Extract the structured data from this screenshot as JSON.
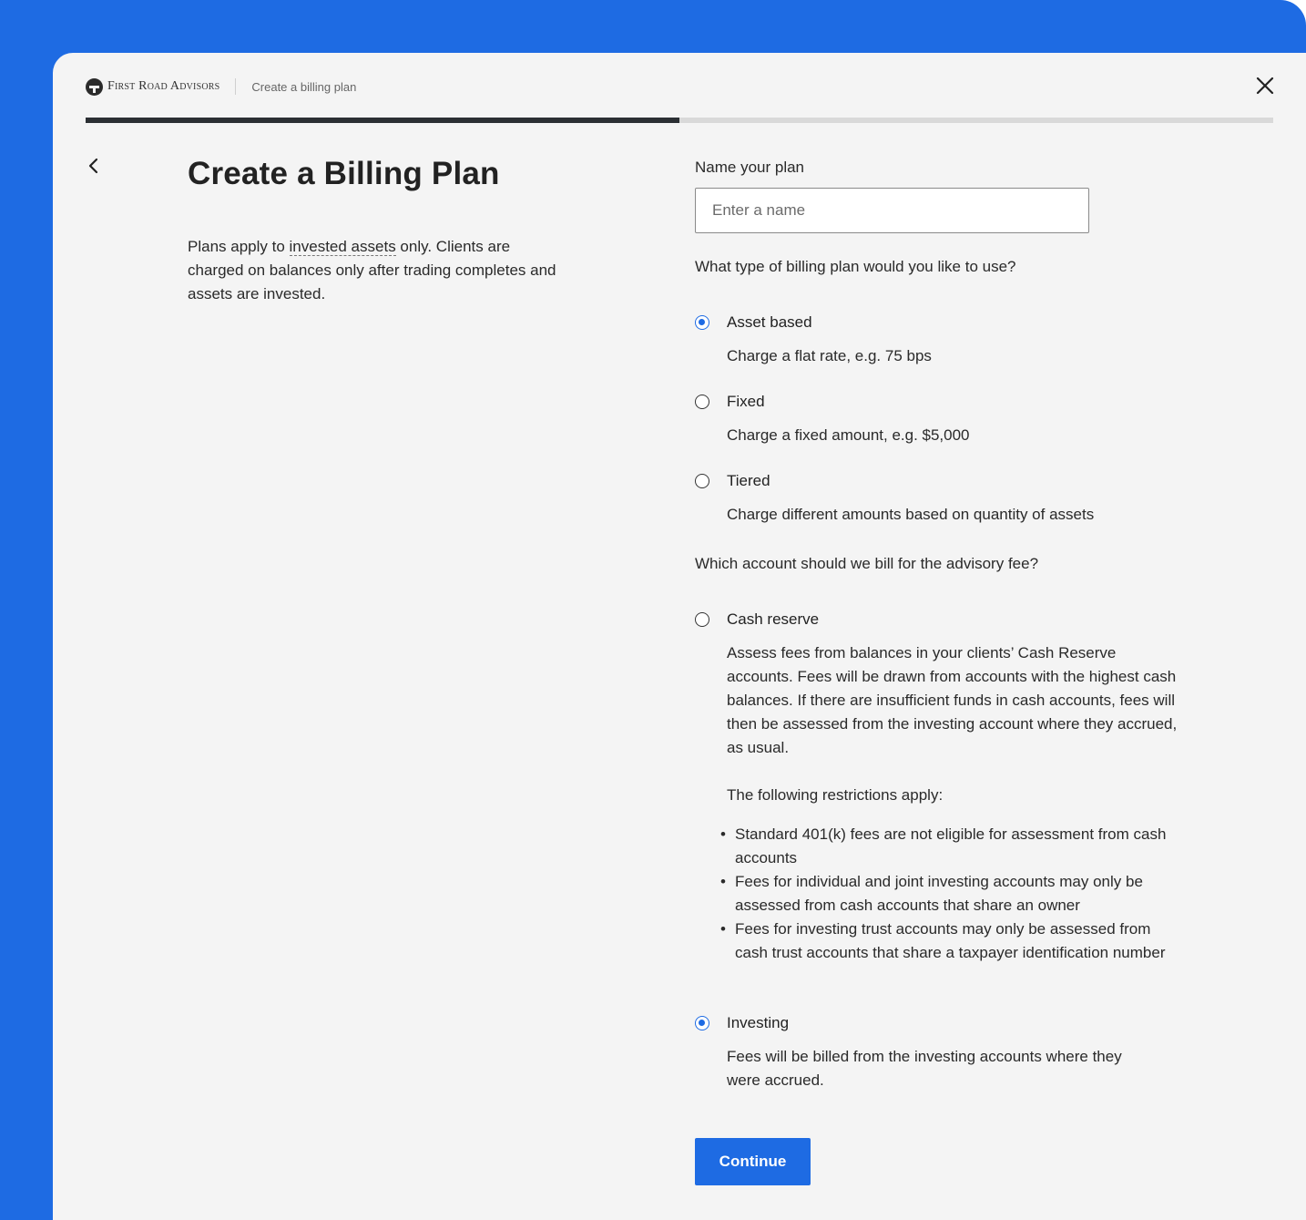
{
  "header": {
    "brand": "First Road Advisors",
    "breadcrumb": "Create a billing plan"
  },
  "progress": {
    "fraction": 0.5
  },
  "main": {
    "title": "Create a Billing Plan",
    "intro_before": "Plans apply to ",
    "intro_link": "invested assets",
    "intro_after": " only. Clients are charged on balances only after trading completes and assets are invested."
  },
  "form": {
    "name_label": "Name your plan",
    "name_placeholder": "Enter a name",
    "name_value": "",
    "plan_type_question": "What type of billing plan would you like to use?",
    "plan_types": [
      {
        "label": "Asset based",
        "description": "Charge a flat rate, e.g. 75 bps",
        "selected": true
      },
      {
        "label": "Fixed",
        "description": "Charge a fixed amount, e.g. $5,000",
        "selected": false
      },
      {
        "label": "Tiered",
        "description": "Charge different amounts based on quantity of assets",
        "selected": false
      }
    ],
    "account_question": "Which account should we bill for the advisory fee?",
    "accounts": [
      {
        "label": "Cash reserve",
        "selected": false,
        "description": "Assess fees from balances in your clients’ Cash Reserve accounts. Fees will be drawn from accounts with the highest cash balances. If there are insufficient funds in cash accounts, fees will then be assessed from the investing account where they accrued, as usual.",
        "restrictions_title": "The following restrictions apply:",
        "restrictions": [
          "Standard 401(k) fees are not eligible for assessment from cash accounts",
          "Fees for individual and joint investing accounts may only be assessed from cash accounts that share an owner",
          "Fees for investing trust accounts may only be assessed from cash trust accounts that share a taxpayer identification number"
        ]
      },
      {
        "label": "Investing",
        "selected": true,
        "description": "Fees will be billed from the investing accounts where they were accrued."
      }
    ],
    "continue_label": "Continue"
  },
  "colors": {
    "accent": "#1e6be3",
    "background": "#f4f4f4",
    "progress": "#2b2f33"
  },
  "icons": {
    "close": "close-icon",
    "back": "chevron-left-icon",
    "logo": "logo-icon"
  }
}
